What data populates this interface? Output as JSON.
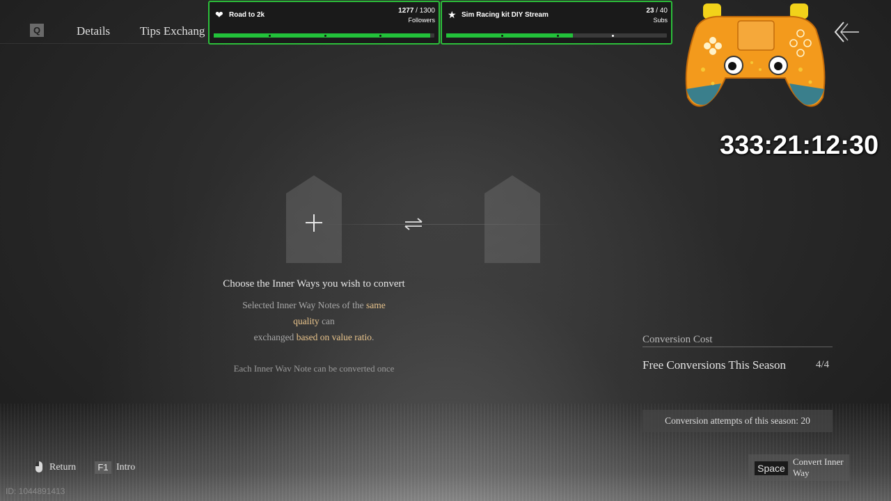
{
  "nav": {
    "q_key": "Q",
    "tab_details": "Details",
    "tab_tips": "Tips Exchang"
  },
  "goals": [
    {
      "icon": "heart-hands-icon",
      "title": "Road to 2k",
      "current": "1277",
      "total": " / 1300",
      "unit": "Followers",
      "progress": 0.982
    },
    {
      "icon": "star-badge-icon",
      "title": "Sim Racing kit DIY Stream",
      "current": "23",
      "total": " / 40",
      "unit": "Subs",
      "progress": 0.575
    }
  ],
  "timer": "333:21:12:30",
  "converter": {
    "instruction_title": "Choose the Inner Ways you wish to convert",
    "line1_a": "Selected Inner Way Notes of the ",
    "line1_b": "same",
    "line2_a": "quality",
    "line2_b": " can",
    "line3_a": "exchanged ",
    "line3_b": "based on value ratio",
    "line3_c": ".",
    "once_note": "Each Inner Wav Note can be converted once"
  },
  "panel": {
    "cost_title": "Conversion Cost",
    "free_label": "Free Conversions This Season",
    "free_value": "4/4",
    "attempts": "Conversion attempts of this season: 20"
  },
  "hints": {
    "return_label": "Return",
    "f1_key": "F1",
    "intro_label": "Intro",
    "space_key": "Space",
    "convert_label": "Convert Inner Way"
  },
  "id_label": "ID: 1044891413",
  "colors": {
    "accent_green": "#2cbf3a",
    "highlight_text": "#e9c48c"
  }
}
